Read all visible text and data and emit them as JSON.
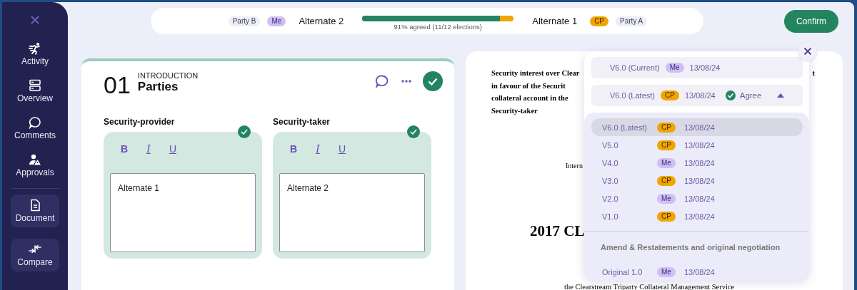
{
  "sidebar": {
    "items": [
      {
        "label": "Activity",
        "selected": false
      },
      {
        "label": "Overview",
        "selected": false
      },
      {
        "label": "Comments",
        "selected": false
      },
      {
        "label": "Approvals",
        "selected": false
      },
      {
        "label": "Document",
        "selected": true
      },
      {
        "label": "Compare",
        "selected": true
      }
    ]
  },
  "top_bar": {
    "tags_left": [
      {
        "label": "Party B",
        "kind": "party"
      },
      {
        "label": "Me",
        "kind": "me"
      }
    ],
    "left_option": "Alternate 2",
    "progress": {
      "level": 0.91,
      "caption": "91% agreed (11/12 elections)"
    },
    "right_option": "Alternate 1",
    "tags_right": [
      {
        "label": "CP",
        "kind": "cp"
      },
      {
        "label": "Party A",
        "kind": "party"
      }
    ]
  },
  "confirm_button": "Confirm",
  "section": {
    "number": "01",
    "category": "INTRODUCTION",
    "title": "Parties",
    "approved": true,
    "fields": [
      {
        "label": "Security-provider",
        "value": "Alternate 1",
        "approved": true,
        "format_buttons": [
          {
            "label": "B",
            "kind": "bold"
          },
          {
            "label": "I",
            "kind": "italic"
          },
          {
            "label": "U",
            "kind": "underline"
          }
        ]
      },
      {
        "label": "Security-taker",
        "value": "Alternate 2",
        "approved": true,
        "format_buttons": [
          {
            "label": "B",
            "kind": "bold"
          },
          {
            "label": "I",
            "kind": "italic"
          },
          {
            "label": "U",
            "kind": "underline"
          }
        ]
      }
    ]
  },
  "document": {
    "paragraph_lines": [
      "Security interest over Clear",
      "in favour of the Securit",
      "collateral account in the",
      "Security-taker"
    ],
    "paragraph_tail": "t",
    "fragment": "Intern",
    "heading": "2017 CL",
    "footer_line": "the Clearstream Triparty Collateral Management Service"
  },
  "version_panel": {
    "current": {
      "version": "V6.0 (Current)",
      "tag": {
        "label": "Me",
        "kind": "me"
      },
      "date": "13/08/24"
    },
    "latest": {
      "version": "V6.0 (Latest)",
      "tag": {
        "label": "CP",
        "kind": "cp"
      },
      "date": "13/08/24",
      "status": "Agree",
      "agreed": true,
      "expanded": true
    },
    "versions": [
      {
        "version": "V6.0 (Latest)",
        "tag": {
          "label": "CP",
          "kind": "cp"
        },
        "date": "13/08/24",
        "selected": true
      },
      {
        "version": "V5.0",
        "tag": {
          "label": "CP",
          "kind": "cp"
        },
        "date": "13/08/24",
        "selected": false
      },
      {
        "version": "V4.0",
        "tag": {
          "label": "Me",
          "kind": "me"
        },
        "date": "13/08/24",
        "selected": false
      },
      {
        "version": "V3.0",
        "tag": {
          "label": "CP",
          "kind": "cp"
        },
        "date": "13/08/24",
        "selected": false
      },
      {
        "version": "V2.0",
        "tag": {
          "label": "Me",
          "kind": "me"
        },
        "date": "13/08/24",
        "selected": false
      },
      {
        "version": "V1.0",
        "tag": {
          "label": "CP",
          "kind": "cp"
        },
        "date": "13/08/24",
        "selected": false
      }
    ],
    "group_heading": "Amend & Restatements and original negotiation",
    "original": [
      {
        "version": "Original 1.0",
        "tag": {
          "label": "Me",
          "kind": "me"
        },
        "date": "13/08/24",
        "selected": false
      }
    ]
  }
}
